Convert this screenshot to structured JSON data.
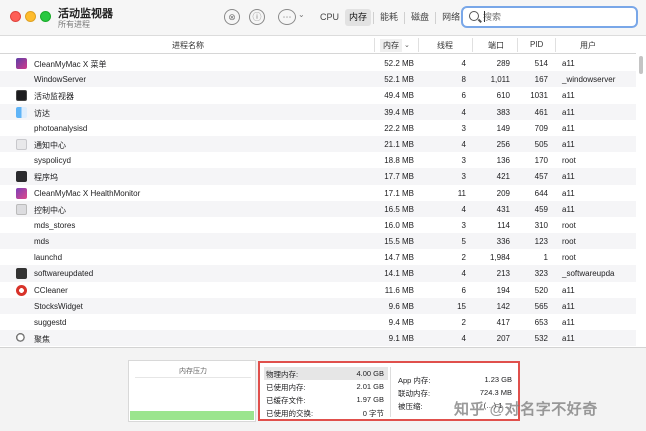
{
  "window": {
    "title": "活动监视器",
    "subtitle": "所有进程"
  },
  "toolbar": {
    "stop_icon": "⊗",
    "info_icon": "ⓘ",
    "more_icon": "⋯",
    "more_caret": "⌄",
    "tabs": [
      {
        "label": "CPU",
        "active": false
      },
      {
        "label": "内存",
        "active": true
      },
      {
        "label": "能耗",
        "active": false
      },
      {
        "label": "磁盘",
        "active": false
      },
      {
        "label": "网络",
        "active": false
      }
    ],
    "search_placeholder": "搜索"
  },
  "table": {
    "columns": {
      "name": "进程名称",
      "memory": "内存",
      "sort_caret": "⌄",
      "threads": "线程",
      "ports": "端口",
      "pid": "PID",
      "user": "用户"
    },
    "rows": [
      {
        "name": "CleanMyMac X 菜单",
        "memory": "52.2 MB",
        "threads": "4",
        "ports": "289",
        "pid": "514",
        "user": "a11",
        "icon": "cleanmymac-menu-icon"
      },
      {
        "name": "WindowServer",
        "memory": "52.1 MB",
        "threads": "8",
        "ports": "1,011",
        "pid": "167",
        "user": "_windowserver",
        "icon": ""
      },
      {
        "name": "活动监视器",
        "memory": "49.4 MB",
        "threads": "6",
        "ports": "610",
        "pid": "1031",
        "user": "a11",
        "icon": "activity-monitor-icon"
      },
      {
        "name": "访达",
        "memory": "39.4 MB",
        "threads": "4",
        "ports": "383",
        "pid": "461",
        "user": "a11",
        "icon": "finder-icon"
      },
      {
        "name": "photoanalysisd",
        "memory": "22.2 MB",
        "threads": "3",
        "ports": "149",
        "pid": "709",
        "user": "a11",
        "icon": ""
      },
      {
        "name": "通知中心",
        "memory": "21.1 MB",
        "threads": "4",
        "ports": "256",
        "pid": "505",
        "user": "a11",
        "icon": "notification-center-icon"
      },
      {
        "name": "syspolicyd",
        "memory": "18.8 MB",
        "threads": "3",
        "ports": "136",
        "pid": "170",
        "user": "root",
        "icon": ""
      },
      {
        "name": "程序坞",
        "memory": "17.7 MB",
        "threads": "3",
        "ports": "421",
        "pid": "457",
        "user": "a11",
        "icon": "dock-icon"
      },
      {
        "name": "CleanMyMac X HealthMonitor",
        "memory": "17.1 MB",
        "threads": "11",
        "ports": "209",
        "pid": "644",
        "user": "a11",
        "icon": "cleanmymac-health-icon"
      },
      {
        "name": "控制中心",
        "memory": "16.5 MB",
        "threads": "4",
        "ports": "431",
        "pid": "459",
        "user": "a11",
        "icon": "control-center-icon"
      },
      {
        "name": "mds_stores",
        "memory": "16.0 MB",
        "threads": "3",
        "ports": "114",
        "pid": "310",
        "user": "root",
        "icon": ""
      },
      {
        "name": "mds",
        "memory": "15.5 MB",
        "threads": "5",
        "ports": "336",
        "pid": "123",
        "user": "root",
        "icon": ""
      },
      {
        "name": "launchd",
        "memory": "14.7 MB",
        "threads": "2",
        "ports": "1,984",
        "pid": "1",
        "user": "root",
        "icon": ""
      },
      {
        "name": "softwareupdated",
        "memory": "14.1 MB",
        "threads": "4",
        "ports": "213",
        "pid": "323",
        "user": "_softwareupda",
        "icon": "softwareupdated-icon"
      },
      {
        "name": "CCleaner",
        "memory": "11.6 MB",
        "threads": "6",
        "ports": "194",
        "pid": "520",
        "user": "a11",
        "icon": "ccleaner-icon"
      },
      {
        "name": "StocksWidget",
        "memory": "9.6 MB",
        "threads": "15",
        "ports": "142",
        "pid": "565",
        "user": "a11",
        "icon": ""
      },
      {
        "name": "suggestd",
        "memory": "9.4 MB",
        "threads": "2",
        "ports": "417",
        "pid": "653",
        "user": "a11",
        "icon": ""
      },
      {
        "name": "聚焦",
        "memory": "9.1 MB",
        "threads": "4",
        "ports": "207",
        "pid": "532",
        "user": "a11",
        "icon": "spotlight-icon"
      }
    ]
  },
  "bottom": {
    "pressure_title": "内存压力",
    "pressure_level": 0.15,
    "stats_left": [
      {
        "label": "物理内存:",
        "value": "4.00 GB"
      },
      {
        "label": "已使用内存:",
        "value": "2.01 GB"
      },
      {
        "label": "已缓存文件:",
        "value": "1.97 GB"
      },
      {
        "label": "已使用的交换:",
        "value": "0 字节"
      }
    ],
    "stats_right": [
      {
        "label": "App 内存:",
        "value": "1.23 GB"
      },
      {
        "label": "联动内存:",
        "value": "724.3 MB"
      },
      {
        "label": "被压缩:",
        "value": "(…) 1 …"
      }
    ]
  },
  "watermark": "知乎 @对名字不好奇",
  "colors": {
    "accent": "#79a7e8",
    "highlight_box": "#e0504c",
    "pressure_green": "#9be58e"
  }
}
